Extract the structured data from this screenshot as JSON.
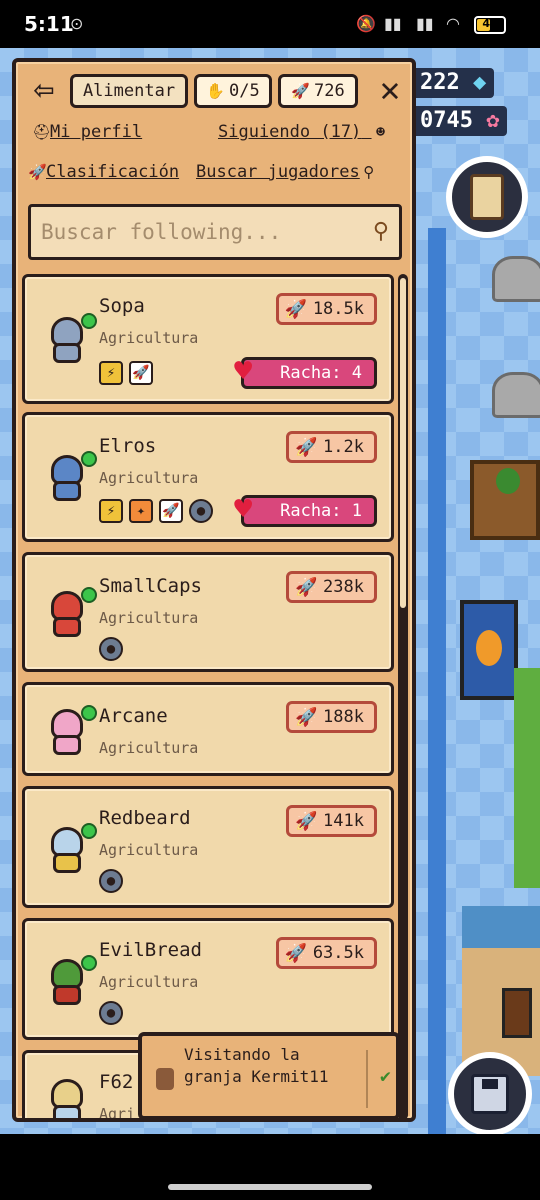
{
  "status_bar": {
    "time": "5:11",
    "battery": "49"
  },
  "hud": {
    "gems": "222",
    "flowers": "0745"
  },
  "topbar": {
    "feed_label": "Alimentar",
    "counter": "0/5",
    "rockets": "726"
  },
  "links": {
    "profile": "Mi perfil",
    "following": "Siguiendo (17)",
    "ranking": "Clasificación",
    "find_players": "Buscar jugadores"
  },
  "search": {
    "placeholder": "Buscar following..."
  },
  "cards": [
    {
      "name": "Sopa",
      "role": "Agricultura",
      "score": "18.5k",
      "streak": "Racha: 4",
      "avatar_color": "#8fa3c0"
    },
    {
      "name": "Elros",
      "role": "Agricultura",
      "score": "1.2k",
      "streak": "Racha: 1",
      "avatar_color": "#5b86c6"
    },
    {
      "name": "SmallCaps",
      "role": "Agricultura",
      "score": "238k",
      "avatar_color": "#d8473a"
    },
    {
      "name": "Arcane",
      "role": "Agricultura",
      "score": "188k",
      "avatar_color": "#f0a6c8"
    },
    {
      "name": "Redbeard",
      "role": "Agricultura",
      "score": "141k",
      "avatar_color": "#b9d4ea"
    },
    {
      "name": "EvilBread",
      "role": "Agricultura",
      "score": "63.5k",
      "avatar_color": "#4f9a3a"
    },
    {
      "name": "F62",
      "role": "Agri",
      "avatar_color": "#e8d08a"
    }
  ],
  "toast": {
    "message": "Visitando la granja Kermit11"
  },
  "colors": {
    "panel": "#e8b379",
    "card": "#f1d9ab",
    "streak": "#d9477c",
    "online": "#3cc54a"
  }
}
